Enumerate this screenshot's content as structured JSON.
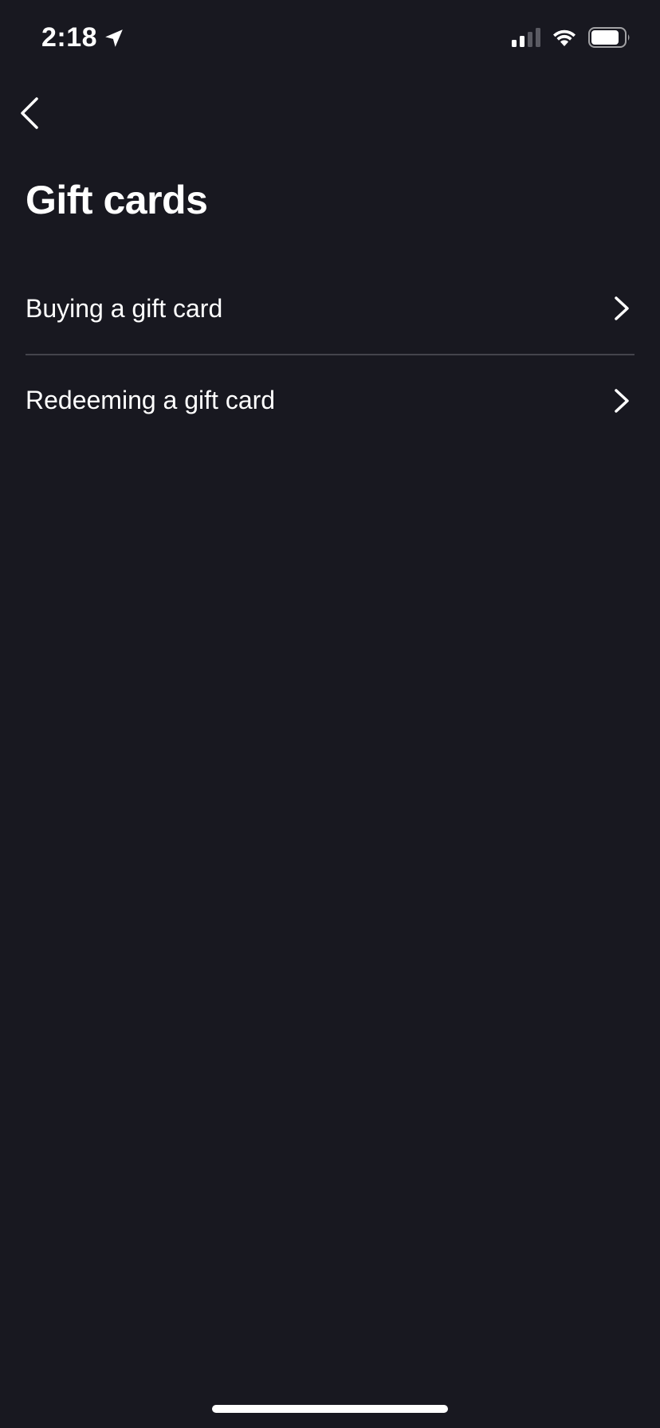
{
  "status_bar": {
    "time": "2:18",
    "icons": [
      "location-arrow-icon",
      "cellular-signal-icon",
      "wifi-icon",
      "battery-icon"
    ]
  },
  "nav": {
    "back_icon": "chevron-left-icon"
  },
  "page": {
    "title": "Gift cards"
  },
  "menu": {
    "items": [
      {
        "label": "Buying a gift card",
        "icon": "chevron-right-icon"
      },
      {
        "label": "Redeeming a gift card",
        "icon": "chevron-right-icon"
      }
    ]
  },
  "colors": {
    "background": "#181820",
    "text": "#ffffff",
    "divider": "#44444c"
  }
}
